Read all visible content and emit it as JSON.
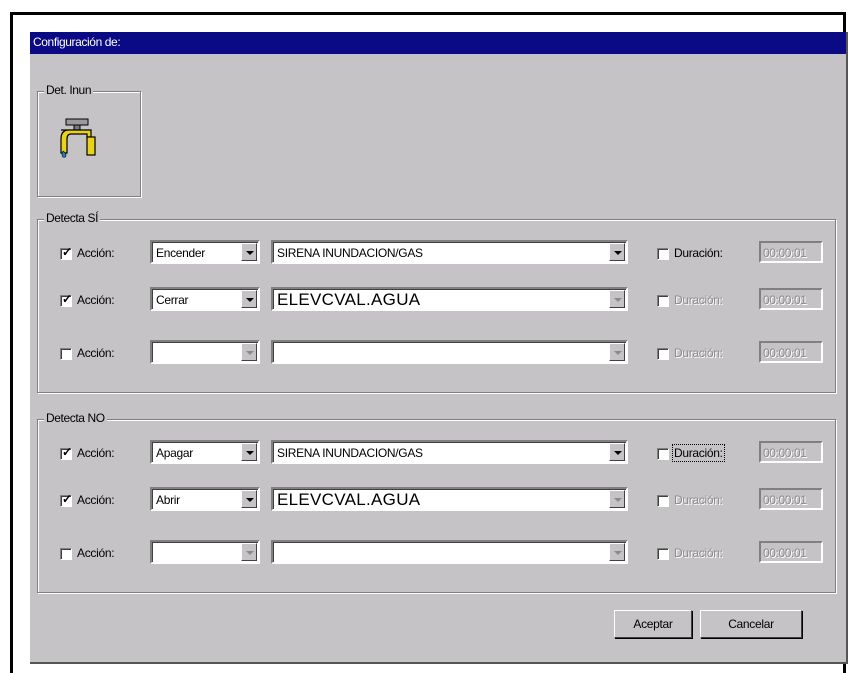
{
  "window": {
    "title": "Configuración de:"
  },
  "device": {
    "group_label": "Det. Inun",
    "icon": "faucet-icon"
  },
  "detecta_si": {
    "label": "Detecta SÍ",
    "rows": [
      {
        "checked": true,
        "accion_label": "Acción:",
        "action": "Encender",
        "target": "SIRENA INUNDACION/GAS",
        "duracion_label": "Duración:",
        "duracion_checked": false,
        "duracion_enabled": true,
        "time": "00:00:01"
      },
      {
        "checked": true,
        "accion_label": "Acción:",
        "action": "Cerrar",
        "target": "ELEVCVAL.AGUA",
        "duracion_label": "Duración:",
        "duracion_checked": false,
        "duracion_enabled": false,
        "time": "00:00:01"
      },
      {
        "checked": false,
        "accion_label": "Acción:",
        "action": "",
        "target": "",
        "duracion_label": "Duración:",
        "duracion_checked": false,
        "duracion_enabled": false,
        "time": "00:00:01"
      }
    ]
  },
  "detecta_no": {
    "label": "Detecta NO",
    "rows": [
      {
        "checked": true,
        "accion_label": "Acción:",
        "action": "Apagar",
        "target": "SIRENA INUNDACION/GAS",
        "duracion_label": "Duración:",
        "duracion_checked": false,
        "duracion_enabled": true,
        "time": "00:00:01"
      },
      {
        "checked": true,
        "accion_label": "Acción:",
        "action": "Abrir",
        "target": "ELEVCVAL.AGUA",
        "duracion_label": "Duración:",
        "duracion_checked": false,
        "duracion_enabled": false,
        "time": "00:00:01"
      },
      {
        "checked": false,
        "accion_label": "Acción:",
        "action": "",
        "target": "",
        "duracion_label": "Duración:",
        "duracion_checked": false,
        "duracion_enabled": false,
        "time": "00:00:01"
      }
    ]
  },
  "buttons": {
    "accept": "Aceptar",
    "cancel": "Cancelar"
  },
  "colors": {
    "titlebar": "#0a0a84",
    "face": "#c6c3c6",
    "faucet": "#e8d21a",
    "water": "#1e7fd6"
  }
}
